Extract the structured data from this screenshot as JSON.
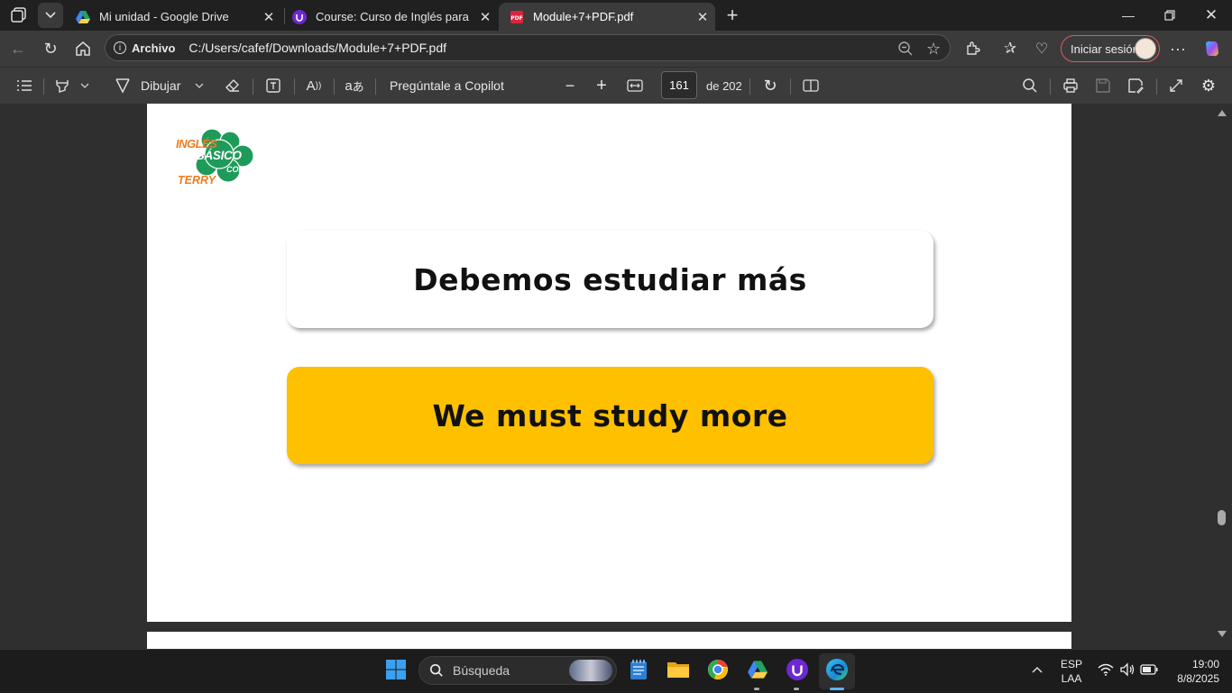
{
  "tabs": [
    {
      "title": "Mi unidad - Google Drive",
      "active": false
    },
    {
      "title": "Course: Curso de Inglés para principiantes",
      "active": false
    },
    {
      "title": "Module+7+PDF.pdf",
      "active": true
    }
  ],
  "address": {
    "label": "Archivo",
    "url": "C:/Users/cafef/Downloads/Module+7+PDF.pdf"
  },
  "signin_label": "Iniciar sesión",
  "pdf_toolbar": {
    "draw_label": "Dibujar",
    "copilot_label": "Pregúntale a Copilot",
    "current_page": "161",
    "page_total": "de 202"
  },
  "document": {
    "logo_lines": [
      "INGLÉS",
      "BÁSICO",
      "CON",
      "TERRY"
    ],
    "spanish_phrase": "Debemos estudiar más",
    "english_phrase": "We must study more"
  },
  "taskbar": {
    "search_placeholder": "Búsqueda",
    "lang_top": "ESP",
    "lang_bottom": "LAA",
    "time": "19:00",
    "date": "8/8/2025"
  },
  "colors": {
    "card_yellow": "#ffc000",
    "logo_green": "#1e9a5a",
    "logo_orange": "#f07c1e"
  }
}
